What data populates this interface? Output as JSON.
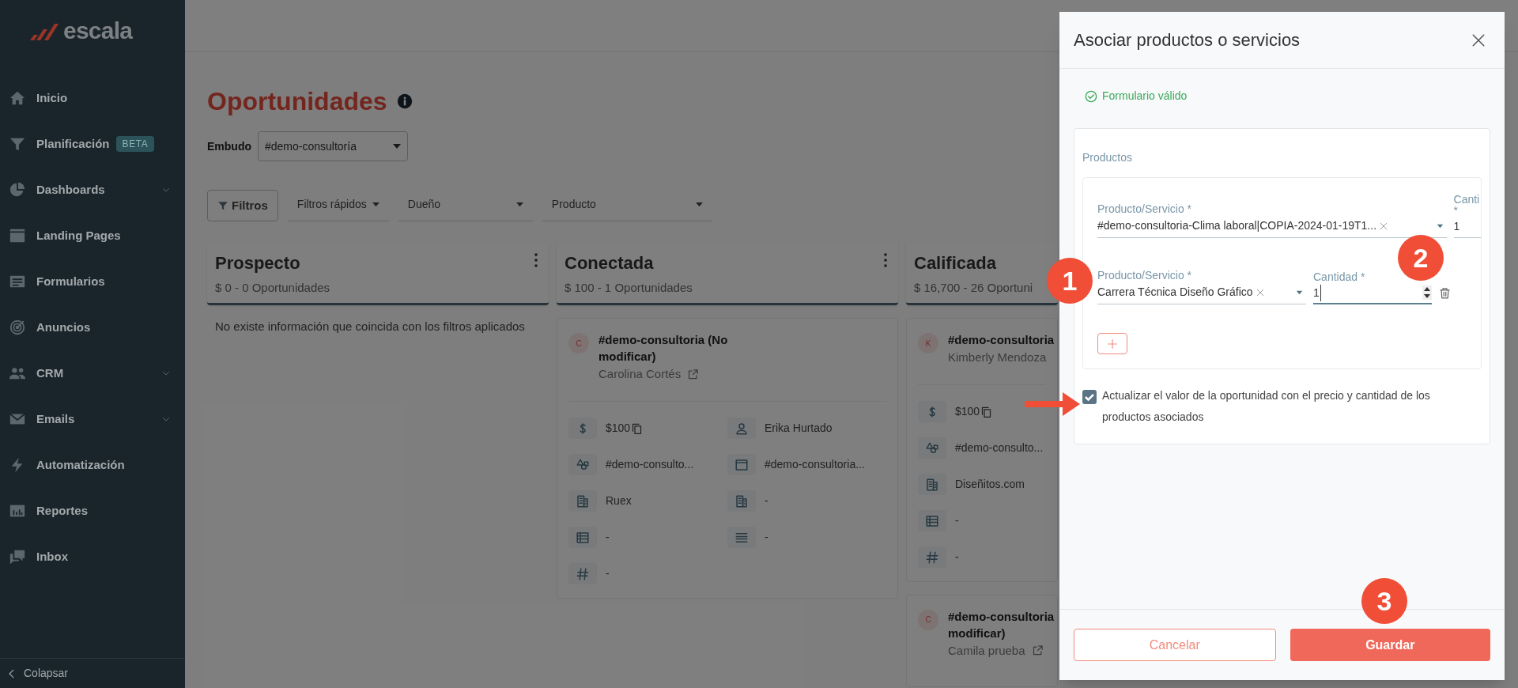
{
  "sidebar": {
    "logo": "escala",
    "items": [
      {
        "label": "Inicio",
        "expandable": false
      },
      {
        "label": "Planificación",
        "expandable": false,
        "badge": "BETA"
      },
      {
        "label": "Dashboards",
        "expandable": true
      },
      {
        "label": "Landing Pages",
        "expandable": false
      },
      {
        "label": "Formularios",
        "expandable": false
      },
      {
        "label": "Anuncios",
        "expandable": false
      },
      {
        "label": "CRM",
        "expandable": true
      },
      {
        "label": "Emails",
        "expandable": true
      },
      {
        "label": "Automatización",
        "expandable": false
      },
      {
        "label": "Reportes",
        "expandable": false
      },
      {
        "label": "Inbox",
        "expandable": false
      }
    ],
    "collapse": "Colapsar"
  },
  "page": {
    "title": "Oportunidades",
    "funnel_label": "Embudo",
    "funnel_value": "#demo-consultoría"
  },
  "filters": {
    "button": "Filtros",
    "dropdowns": [
      "Filtros rápidos",
      "Dueño",
      "Producto"
    ]
  },
  "columns": [
    {
      "title": "Prospecto",
      "summary": "$ 0 - 0 Oportunidades",
      "empty_message": "No existe información que coincida con los filtros aplicados"
    },
    {
      "title": "Conectada",
      "summary": "$ 100 - 1 Oportunidades",
      "cards": [
        {
          "initial": "C",
          "title": "#demo-consultoria (No modificar)",
          "contact": "Carolina Cortés",
          "link_icon": true,
          "fields": [
            {
              "kind": "dollar",
              "value": "$100",
              "copy": true
            },
            {
              "kind": "person",
              "value": "Erika Hurtado",
              "copy": false
            },
            {
              "kind": "shapes",
              "value": "#demo-consulto...",
              "copy": false
            },
            {
              "kind": "window",
              "value": "#demo-consultoria...",
              "copy": false
            },
            {
              "kind": "building",
              "value": "Ruex",
              "copy": false
            },
            {
              "kind": "building",
              "value": "-",
              "copy": false
            },
            {
              "kind": "table",
              "value": "-",
              "copy": false
            },
            {
              "kind": "lines",
              "value": "-",
              "copy": false
            },
            {
              "kind": "hash",
              "value": "-",
              "copy": false
            }
          ]
        }
      ]
    },
    {
      "title": "Calificada",
      "summary": "$ 16,700 - 26 Oportuni",
      "cards": [
        {
          "initial": "K",
          "title": "#demo-consultoria",
          "contact": "Kimberly Mendoza",
          "link_icon": false,
          "fields": [
            {
              "kind": "dollar",
              "value": "$100",
              "copy": true
            },
            {
              "kind": "shapes",
              "value": "#demo-consulto...",
              "copy": false
            },
            {
              "kind": "building",
              "value": "Diseñitos.com",
              "copy": false
            },
            {
              "kind": "table",
              "value": "-",
              "copy": false
            },
            {
              "kind": "hash",
              "value": "-",
              "copy": false
            }
          ]
        },
        {
          "initial": "C",
          "title": "#demo-consultoria modificar)",
          "contact": "Camila prueba",
          "link_icon": true
        }
      ]
    }
  ],
  "drawer": {
    "title": "Asociar productos o servicios",
    "status": "Formulario válido",
    "section": "Productos",
    "rows": [
      {
        "product_label": "Producto/Servicio *",
        "product_value": "#demo-consultoria-Clima laboral|COPIA-2024-01-19T1...",
        "quantity_label": "Canti *",
        "quantity_value": "1",
        "focused": false,
        "deletable": false
      },
      {
        "product_label": "Producto/Servicio *",
        "product_value": "Carrera Técnica Diseño Gráfico",
        "quantity_label": "Cantidad *",
        "quantity_value": "1",
        "focused": true,
        "deletable": true
      }
    ],
    "checkbox": {
      "label": "Actualizar el valor de la oportunidad con el precio y cantidad de los productos asociados",
      "checked": true
    },
    "cancel": "Cancelar",
    "save": "Guardar"
  },
  "annotations": [
    {
      "kind": "badge",
      "label": "1"
    },
    {
      "kind": "badge",
      "label": "2"
    },
    {
      "kind": "arrow"
    },
    {
      "kind": "badge",
      "label": "3"
    }
  ]
}
